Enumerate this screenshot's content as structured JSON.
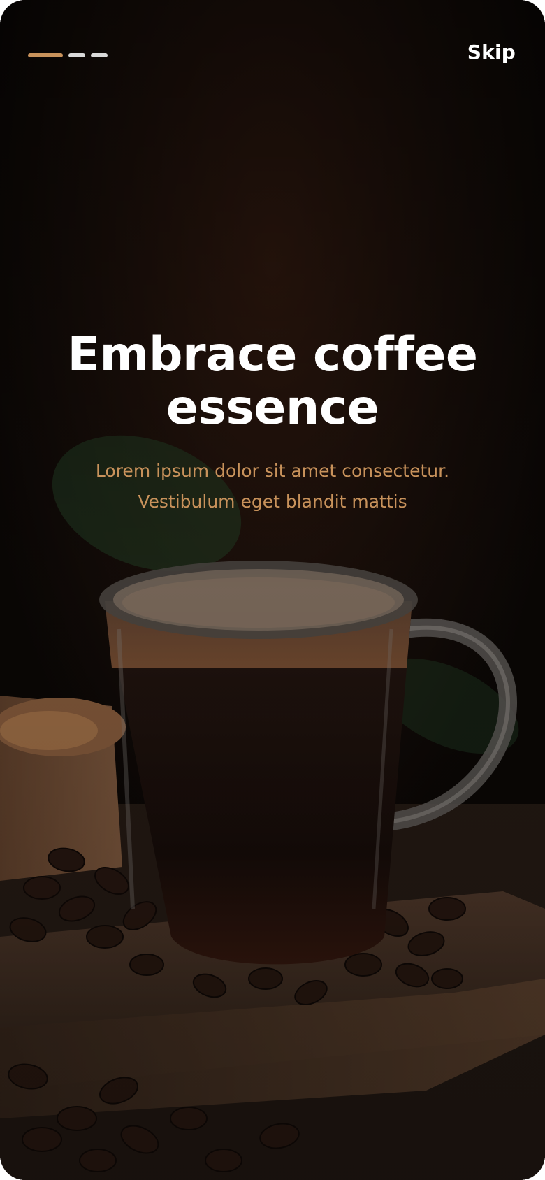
{
  "header": {
    "skip_label": "Skip",
    "progress": {
      "total_steps": 3,
      "current_step": 1
    }
  },
  "content": {
    "title_line1": "Embrace coffee",
    "title_line2": "essence",
    "subtitle_line1": "Lorem ipsum dolor sit amet consectetur.",
    "subtitle_line2": "Vestibulum eget blandit mattis"
  },
  "colors": {
    "accent": "#c8925b",
    "inactive_dash": "#d9d9d9",
    "title": "#ffffff",
    "background": "#0f0a08"
  },
  "background_image": {
    "subject": "glass mug of black coffee on wooden board with coffee beans"
  }
}
